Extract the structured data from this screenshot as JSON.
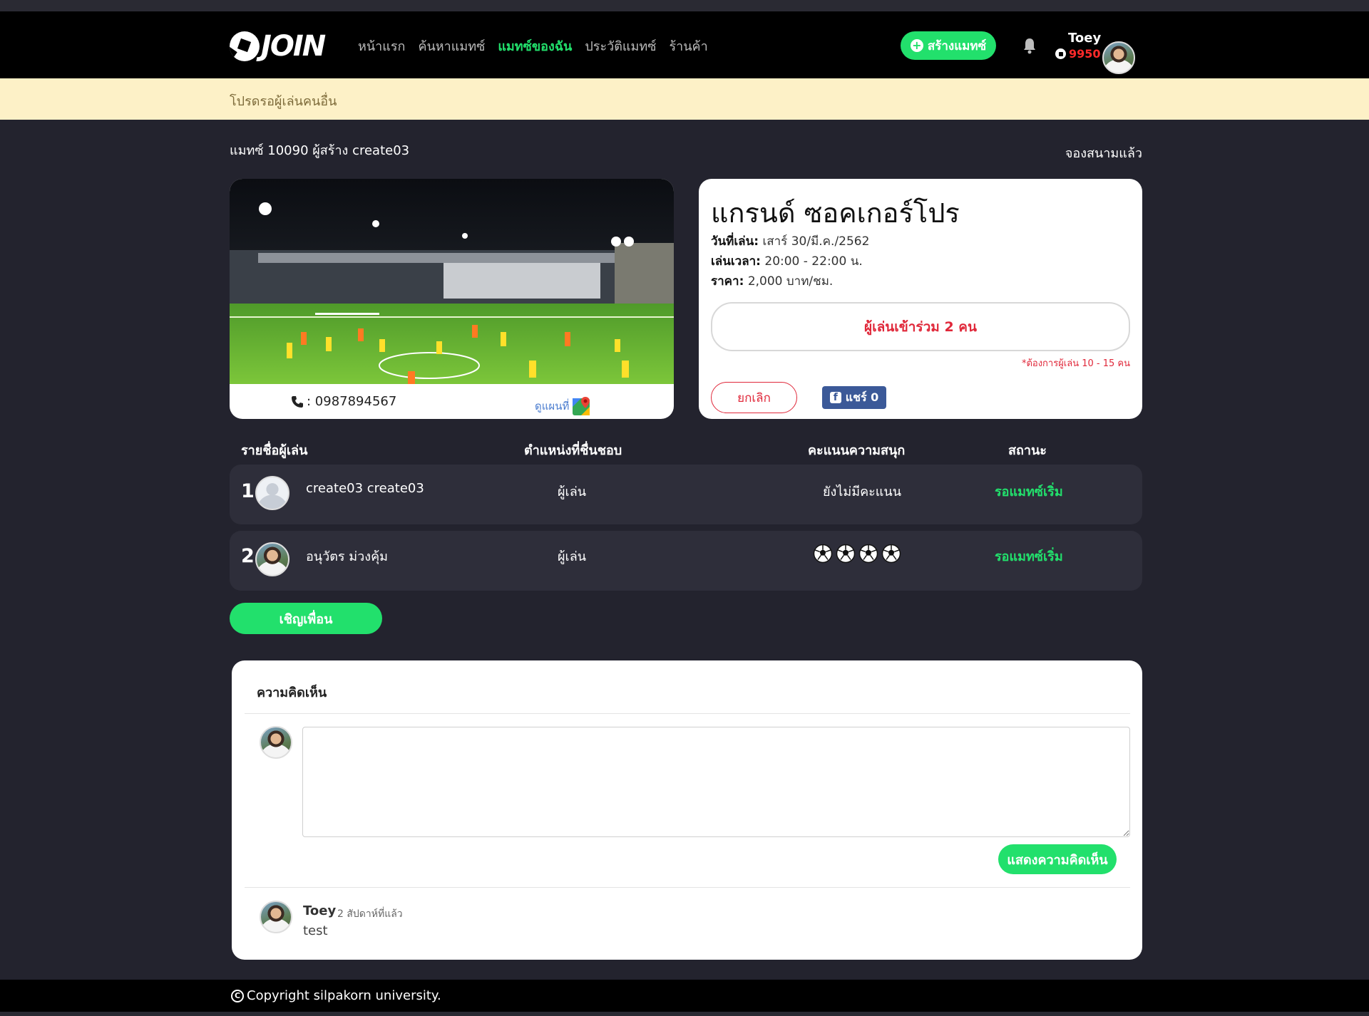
{
  "brand": {
    "logo_text": "JOIN"
  },
  "nav": {
    "items": [
      {
        "label": "หน้าแรก",
        "active": false
      },
      {
        "label": "ค้นหาแมทซ์",
        "active": false
      },
      {
        "label": "แมทซ์ของฉัน",
        "active": true
      },
      {
        "label": "ประวัติแมทซ์",
        "active": false
      },
      {
        "label": "ร้านค้า",
        "active": false
      }
    ],
    "create_button": "สร้างแมทซ์",
    "user_name": "Toey",
    "user_points": "9950"
  },
  "banner": {
    "text": "โปรดรอผู้เล่นคนอื่น"
  },
  "match": {
    "title": "แมทซ์ 10090 ผู้สร้าง create03",
    "status": "จองสนามแล้ว",
    "phone": ": 0987894567",
    "map_link": "ดูแผนที่"
  },
  "info": {
    "stadium": "แกรนด์ ซอคเกอร์โปร",
    "date_label": "วันที่เล่น:",
    "date_value": "เสาร์ 30/มี.ค./2562",
    "time_label": "เล่นเวลา:",
    "time_value": "20:00 - 22:00 น.",
    "price_label": "ราคา:",
    "price_value": "2,000 บาท/ชม.",
    "joined": "ผู้เล่นเข้าร่วม 2 คน",
    "need": "*ต้องการผู้เล่น 10 - 15 คน",
    "cancel_button": "ยกเลิก",
    "share_button": "แชร์ 0"
  },
  "players": {
    "headers": [
      "รายชื่อผู้เล่น",
      "ตำแหน่งที่ชื่นชอบ",
      "คะแนนความสนุก",
      "สถานะ"
    ],
    "rows": [
      {
        "num": "1",
        "name": "create03 create03",
        "position": "ผู้เล่น",
        "score": "ยังไม่มีคะแนน",
        "status": "รอแมทซ์เริ่ม"
      },
      {
        "num": "2",
        "name": "อนุวัตร ม่วงคุ้ม",
        "position": "ผู้เล่น",
        "score_balls": 4,
        "status": "รอแมทซ์เริ่ม"
      }
    ],
    "invite_button": "เชิญเพื่อน"
  },
  "comments": {
    "title": "ความคิดเห็น",
    "input_value": "",
    "post_button": "แสดงความคิดเห็น",
    "items": [
      {
        "name": "Toey",
        "time": "2 สัปดาห์ที่แล้ว",
        "text": "test"
      }
    ]
  },
  "footer": {
    "text": "Copyright silpakorn university."
  },
  "colors": {
    "accent": "#22e06c",
    "danger": "#e0283a",
    "background": "#23232e",
    "banner": "#fdf1c7"
  }
}
